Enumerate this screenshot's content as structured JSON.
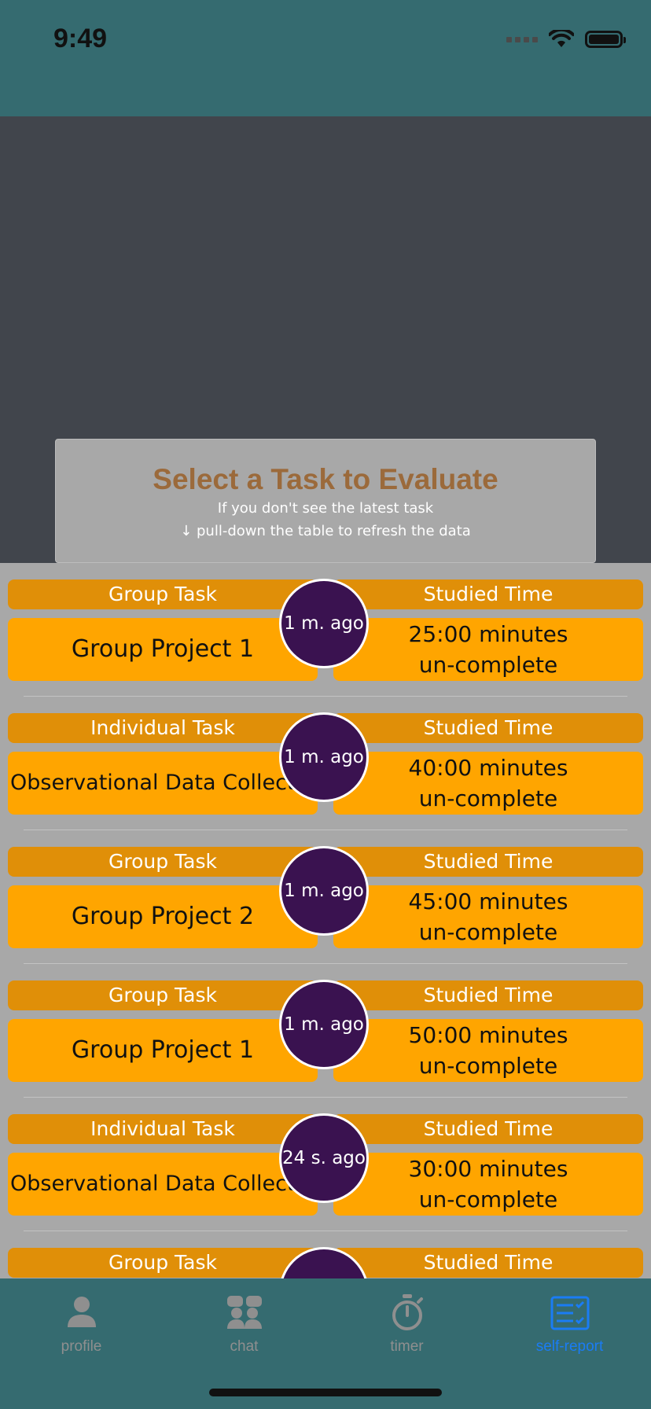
{
  "status_bar": {
    "time": "9:49"
  },
  "header": {
    "title": "Select a Task to Evaluate",
    "subtitle_line1": "If you don't see the latest task",
    "subtitle_line2": "↓ pull-down the table to refresh the data"
  },
  "rows": [
    {
      "type_label": "Group Task",
      "time_label": "Studied Time",
      "task_name": "Group Project 1",
      "duration": "25:00 minutes",
      "status": "un-complete",
      "ago": "1 m. ago"
    },
    {
      "type_label": "Individual Task",
      "time_label": "Studied Time",
      "task_name": "Observational Data Collection",
      "duration": "40:00 minutes",
      "status": "un-complete",
      "ago": "1 m. ago"
    },
    {
      "type_label": "Group Task",
      "time_label": "Studied Time",
      "task_name": "Group Project 2",
      "duration": "45:00 minutes",
      "status": "un-complete",
      "ago": "1 m. ago"
    },
    {
      "type_label": "Group Task",
      "time_label": "Studied Time",
      "task_name": "Group Project 1",
      "duration": "50:00 minutes",
      "status": "un-complete",
      "ago": "1 m. ago"
    },
    {
      "type_label": "Individual Task",
      "time_label": "Studied Time",
      "task_name": "Observational Data Collection",
      "duration": "30:00 minutes",
      "status": "un-complete",
      "ago": "24 s. ago"
    },
    {
      "type_label": "Group Task",
      "time_label": "Studied Time"
    }
  ],
  "tabs": [
    {
      "label": "profile",
      "icon": "person-icon"
    },
    {
      "label": "chat",
      "icon": "group-chat-icon"
    },
    {
      "label": "timer",
      "icon": "stopwatch-icon"
    },
    {
      "label": "self-report",
      "icon": "report-icon",
      "active": true
    }
  ],
  "colors": {
    "status_bar": "#356b70",
    "label_bar": "#e08f08",
    "value_cell": "#ffa500",
    "bubble": "#3a1250",
    "title": "#9b6a3b",
    "active_tab": "#1a7cf5"
  }
}
